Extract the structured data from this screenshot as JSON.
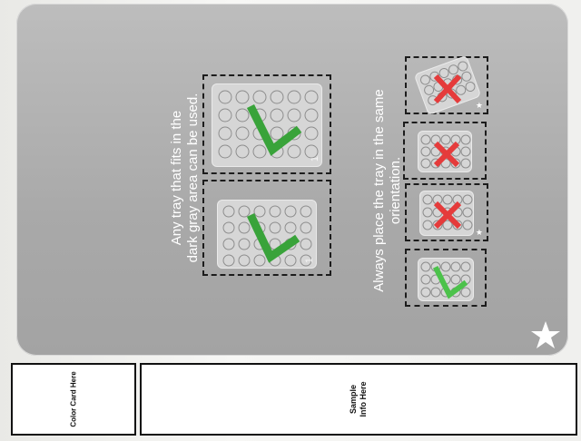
{
  "board": {
    "instruction_any_tray_line1": "Any tray that fits in the",
    "instruction_any_tray_line2": "dark gray area can be used.",
    "instruction_orientation_line1": "Always place the tray in the same",
    "instruction_orientation_line2": "orientation."
  },
  "trays_large": [
    {
      "status": "correct",
      "corner_mark": "1"
    },
    {
      "status": "correct",
      "corner_mark": "1"
    }
  ],
  "trays_small": [
    {
      "status": "incorrect"
    },
    {
      "status": "incorrect"
    },
    {
      "status": "incorrect"
    },
    {
      "status": "correct"
    }
  ],
  "labels": {
    "color_card": "Color Card Here",
    "sample_line1": "Sample",
    "sample_line2": "Info Here"
  },
  "colors": {
    "check": "#39a33a",
    "cross": "#e53b3b",
    "board": "#a9a9a9"
  },
  "icons": {
    "corner": "star-icon",
    "correct": "check-icon",
    "incorrect": "cross-icon"
  }
}
